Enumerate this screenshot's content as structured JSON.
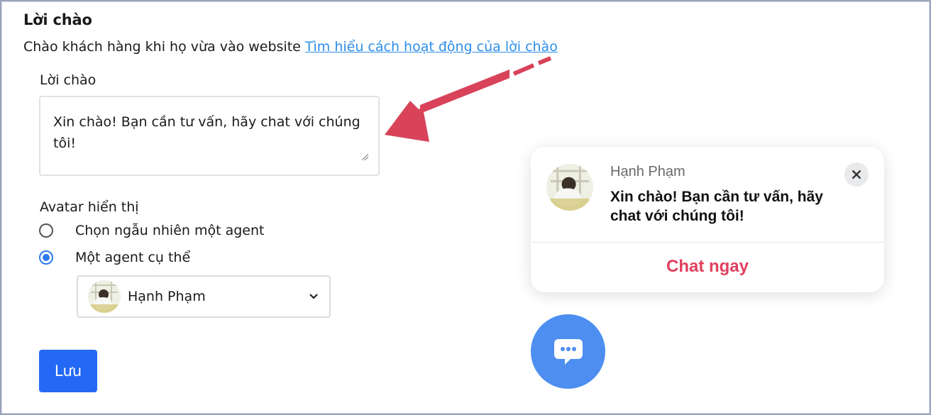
{
  "section": {
    "title": "Lời chào",
    "description": "Chào khách hàng khi họ vừa vào website",
    "help_link": "Tìm hiểu cách hoạt động của lời chào"
  },
  "greeting": {
    "label": "Lời chào",
    "value": "Xin chào! Bạn cần tư vấn, hãy chat với chúng tôi!"
  },
  "avatar_display": {
    "label": "Avatar hiển thị",
    "options": [
      {
        "label": "Chọn ngẫu nhiên một agent",
        "selected": false
      },
      {
        "label": "Một agent cụ thể",
        "selected": true
      }
    ],
    "selected_agent": "Hạnh Phạm"
  },
  "save_button": {
    "label": "Lưu"
  },
  "preview": {
    "agent_name": "Hạnh Phạm",
    "message": "Xin chào! Bạn cần tư vấn, hãy chat với chúng tôi!",
    "cta": "Chat ngay",
    "close_icon": "close-icon",
    "launcher_icon": "chat-bubble-icon"
  },
  "colors": {
    "link": "#2d8ee8",
    "primary": "#2469f5",
    "cta": "#e0405e",
    "launcher": "#4d8ef0",
    "annotation_arrow": "#d8435a"
  }
}
